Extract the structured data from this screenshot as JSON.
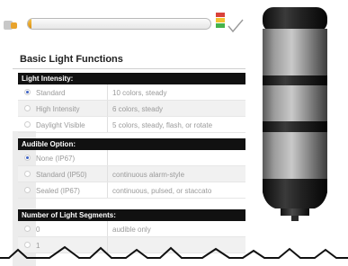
{
  "progress": {
    "value": 0.02
  },
  "panel": {
    "title": "Basic Light Functions",
    "sections": [
      {
        "heading": "Light Intensity:",
        "rows": [
          {
            "label": "Standard",
            "desc": "10 colors, steady",
            "selected": true
          },
          {
            "label": "High Intensity",
            "desc": "6 colors, steady",
            "selected": false
          },
          {
            "label": "Daylight Visible",
            "desc": "5 colors, steady, flash, or rotate",
            "selected": false
          }
        ]
      },
      {
        "heading": "Audible Option:",
        "rows": [
          {
            "label": "None (IP67)",
            "desc": "",
            "selected": true
          },
          {
            "label": "Standard (IP50)",
            "desc": "continuous alarm-style",
            "selected": false
          },
          {
            "label": "Sealed (IP67)",
            "desc": "continuous, pulsed, or staccato",
            "selected": false
          }
        ]
      },
      {
        "heading": "Number of Light Segments:",
        "rows": [
          {
            "label": "0",
            "desc": "audible only",
            "selected": false
          },
          {
            "label": "1",
            "desc": "",
            "selected": false
          }
        ]
      }
    ]
  },
  "colors": {
    "accent": "#e8a32c",
    "header_bg": "#111111",
    "radio_on": "#3f63c4",
    "stack": [
      "#d9423b",
      "#f2c230",
      "#45b34a"
    ]
  },
  "icons": {
    "bar": "tower-bar-icon",
    "stack": "tower-stack-icon",
    "check": "checkmark-icon",
    "product": "light-tower-image"
  }
}
